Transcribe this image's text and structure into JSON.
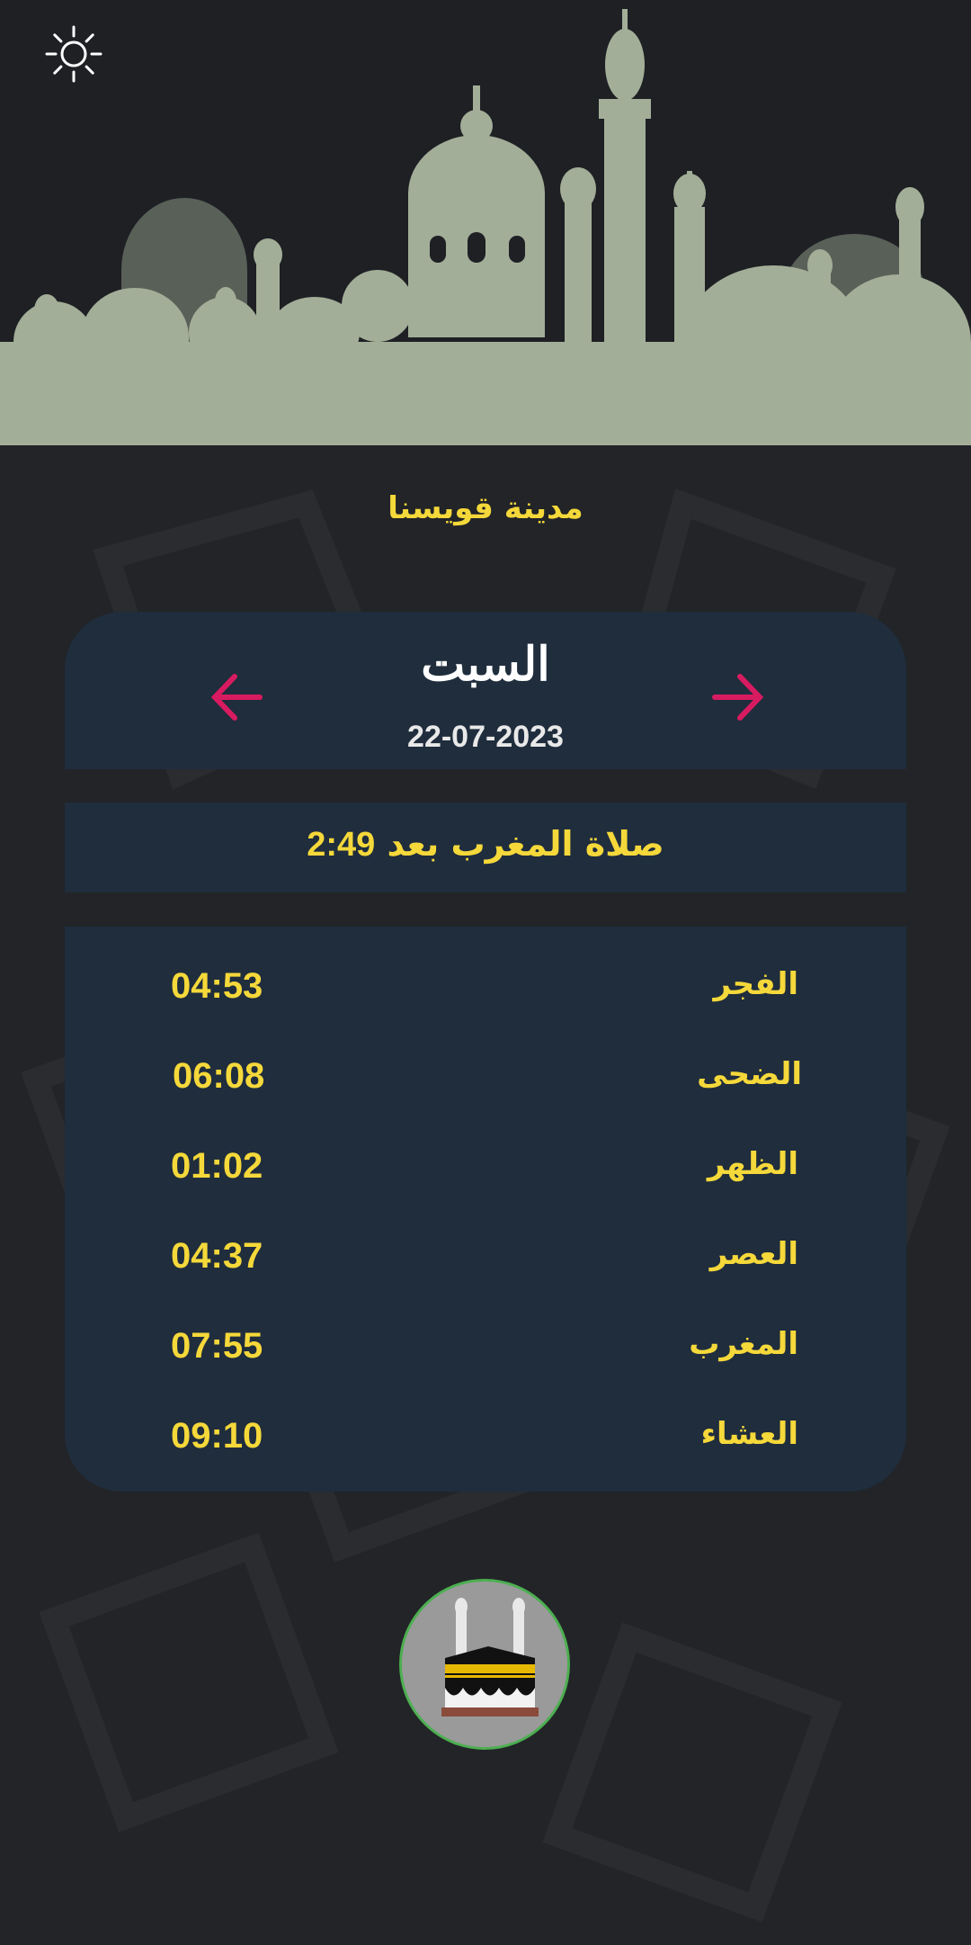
{
  "city": "مدينة قويسنا",
  "day": {
    "name": "السبت",
    "date": "22-07-2023"
  },
  "next_prayer": {
    "label": "صلاة المغرب بعد",
    "time": "2:49"
  },
  "prayers": [
    {
      "name": "الفجر",
      "time": "04:53"
    },
    {
      "name": "الضحى",
      "time": "06:08"
    },
    {
      "name": "الظهر",
      "time": "01:02"
    },
    {
      "name": "العصر",
      "time": "04:37"
    },
    {
      "name": "المغرب",
      "time": "07:55"
    },
    {
      "name": "العشاء",
      "time": "09:10"
    }
  ],
  "icons": {
    "theme": "sun-icon",
    "prev": "arrow-left-icon",
    "next": "arrow-right-icon",
    "kaaba": "kaaba-icon"
  },
  "colors": {
    "background": "#222427",
    "card": "#1f2d3d",
    "accent_text": "#f5d83a",
    "arrow": "#d81b60",
    "mosque_silhouette": "#a3ae98",
    "kaaba_border": "#4caf50"
  }
}
